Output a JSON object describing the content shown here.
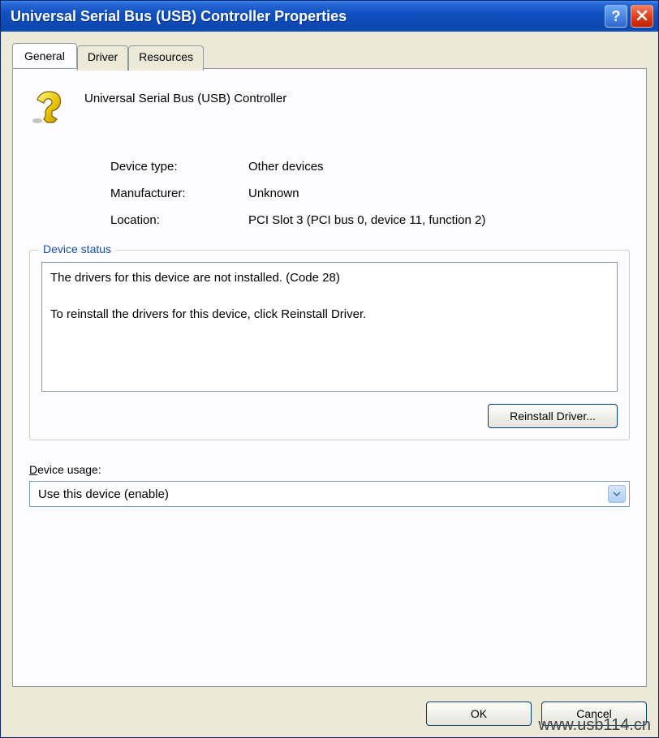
{
  "titlebar": {
    "title": "Universal Serial Bus (USB) Controller Properties"
  },
  "tabs": {
    "general": "General",
    "driver": "Driver",
    "resources": "Resources"
  },
  "device": {
    "name": "Universal Serial Bus (USB) Controller",
    "type_label": "Device type:",
    "type_value": "Other devices",
    "manufacturer_label": "Manufacturer:",
    "manufacturer_value": "Unknown",
    "location_label": "Location:",
    "location_value": "PCI Slot 3 (PCI bus 0, device 11, function 2)"
  },
  "status": {
    "legend": "Device status",
    "text": "The drivers for this device are not installed. (Code 28)\n\nTo reinstall the drivers for this device, click Reinstall Driver.",
    "reinstall_button": "Reinstall Driver..."
  },
  "usage": {
    "label_prefix": "D",
    "label_rest": "evice usage:",
    "selected": "Use this device (enable)"
  },
  "footer": {
    "ok": "OK",
    "cancel": "Cancel"
  },
  "watermark": "www.usb114.cn"
}
